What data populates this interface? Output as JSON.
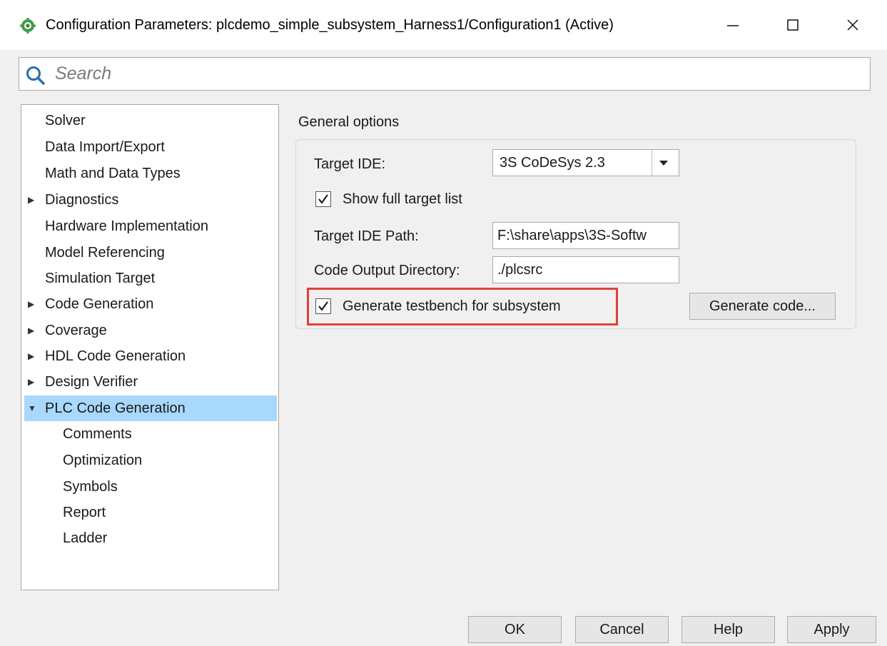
{
  "window": {
    "title": "Configuration Parameters: plcdemo_simple_subsystem_Harness1/Configuration1 (Active)",
    "app_icon": "simulink-gear-icon",
    "controls": [
      "minimize-icon",
      "maximize-icon",
      "close-icon"
    ]
  },
  "search": {
    "placeholder": "Search",
    "icon": "search-icon"
  },
  "nav": {
    "items": [
      {
        "label": "Solver",
        "expandable": false,
        "level": 0
      },
      {
        "label": "Data Import/Export",
        "expandable": false,
        "level": 0
      },
      {
        "label": "Math and Data Types",
        "expandable": false,
        "level": 0
      },
      {
        "label": "Diagnostics",
        "expandable": true,
        "expanded": false,
        "level": 0
      },
      {
        "label": "Hardware Implementation",
        "expandable": false,
        "level": 0
      },
      {
        "label": "Model Referencing",
        "expandable": false,
        "level": 0
      },
      {
        "label": "Simulation Target",
        "expandable": false,
        "level": 0
      },
      {
        "label": "Code Generation",
        "expandable": true,
        "expanded": false,
        "level": 0
      },
      {
        "label": "Coverage",
        "expandable": true,
        "expanded": false,
        "level": 0
      },
      {
        "label": "HDL Code Generation",
        "expandable": true,
        "expanded": false,
        "level": 0
      },
      {
        "label": "Design Verifier",
        "expandable": true,
        "expanded": false,
        "level": 0
      },
      {
        "label": "PLC Code Generation",
        "expandable": true,
        "expanded": true,
        "selected": true,
        "level": 0
      },
      {
        "label": "Comments",
        "expandable": false,
        "level": 1
      },
      {
        "label": "Optimization",
        "expandable": false,
        "level": 1
      },
      {
        "label": "Symbols",
        "expandable": false,
        "level": 1
      },
      {
        "label": "Report",
        "expandable": false,
        "level": 1
      },
      {
        "label": "Ladder",
        "expandable": false,
        "level": 1
      }
    ]
  },
  "general_options": {
    "section_title": "General options",
    "target_ide": {
      "label": "Target IDE:",
      "value": "3S CoDeSys 2.3"
    },
    "show_full_target_list": {
      "label": "Show full target list",
      "checked": true
    },
    "target_ide_path": {
      "label": "Target IDE Path:",
      "value": "F:\\share\\apps\\3S-Softw"
    },
    "code_output_directory": {
      "label": "Code Output Directory:",
      "value": "./plcsrc"
    },
    "generate_testbench": {
      "label": "Generate testbench for subsystem",
      "checked": true,
      "highlighted": true
    },
    "generate_code_button": "Generate code..."
  },
  "footer": {
    "ok": "OK",
    "cancel": "Cancel",
    "help": "Help",
    "apply": "Apply"
  },
  "colors": {
    "selection": "#a8d8fc",
    "highlight_border": "#e0403c",
    "background": "#f0f0f0"
  }
}
